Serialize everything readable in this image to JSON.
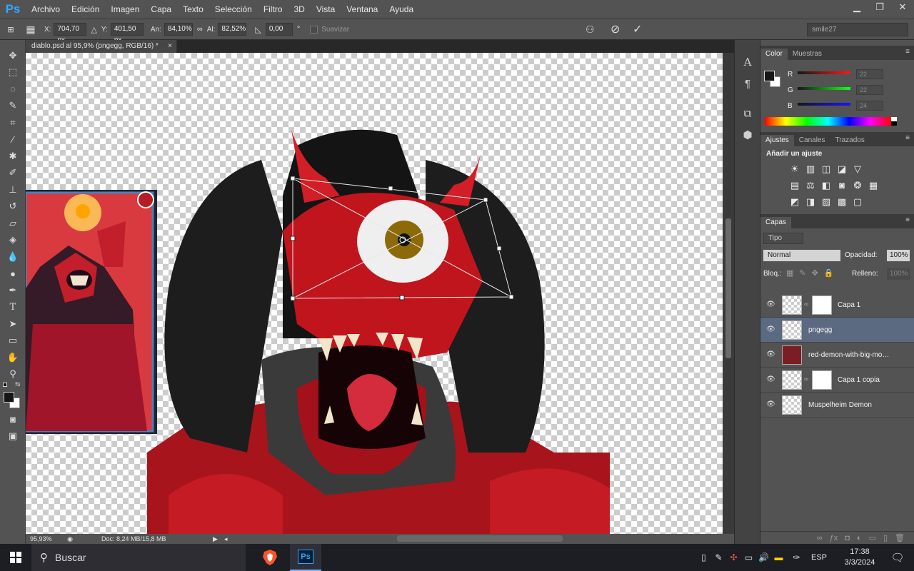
{
  "app": {
    "logo": "Ps"
  },
  "menu": [
    "Archivo",
    "Edición",
    "Imagen",
    "Capa",
    "Texto",
    "Selección",
    "Filtro",
    "3D",
    "Vista",
    "Ventana",
    "Ayuda"
  ],
  "window_controls": {
    "minimize": "▁",
    "restore": "❐",
    "close": "✕"
  },
  "options": {
    "x_label": "X:",
    "x_value": "704,70 px",
    "y_label": "Y:",
    "y_value": "401,50 px",
    "w_label": "An:",
    "w_value": "84,10%",
    "h_label": "Al:",
    "h_value": "82,52%",
    "angle_value": "0,00",
    "angle_unit": "°",
    "smooth_label": "Suavizar",
    "workspace": "smile27"
  },
  "document": {
    "tab_title": "diablo.psd al 95,9% (pngegg, RGB/16) *",
    "zoom": "95,93%",
    "doc_info": "Doc: 8,24 MB/15,8 MB"
  },
  "panels": {
    "color_tabs": [
      "Color",
      "Muestras"
    ],
    "rgb": [
      {
        "label": "R",
        "value": "22"
      },
      {
        "label": "G",
        "value": "22"
      },
      {
        "label": "B",
        "value": "24"
      }
    ],
    "adjust_tabs": [
      "Ajustes",
      "Canales",
      "Trazados"
    ],
    "adjust_title": "Añadir un ajuste",
    "layers_tab": "Capas",
    "filter_kind": "Tipo",
    "blend_mode": "Normal",
    "opacity_label": "Opacidad:",
    "opacity_value": "100%",
    "lock_label": "Bloq.:",
    "fill_label": "Relleno:",
    "fill_value": "100%",
    "layers": [
      {
        "name": "Capa 1",
        "has_mask": true,
        "selected": false
      },
      {
        "name": "pngegg",
        "has_mask": false,
        "selected": true
      },
      {
        "name": "red-demon-with-big-mouth-...",
        "has_mask": false,
        "selected": false
      },
      {
        "name": "Capa 1 copia",
        "has_mask": true,
        "selected": false
      },
      {
        "name": "Muspelheim Demon",
        "has_mask": false,
        "selected": false
      }
    ]
  },
  "taskbar": {
    "search_placeholder": "Buscar",
    "lang": "ESP",
    "time": "17:38",
    "date": "3/3/2024"
  },
  "colors": {
    "accent": "#31a8ff",
    "selected_layer": "#5b6981",
    "panel": "#535353"
  }
}
